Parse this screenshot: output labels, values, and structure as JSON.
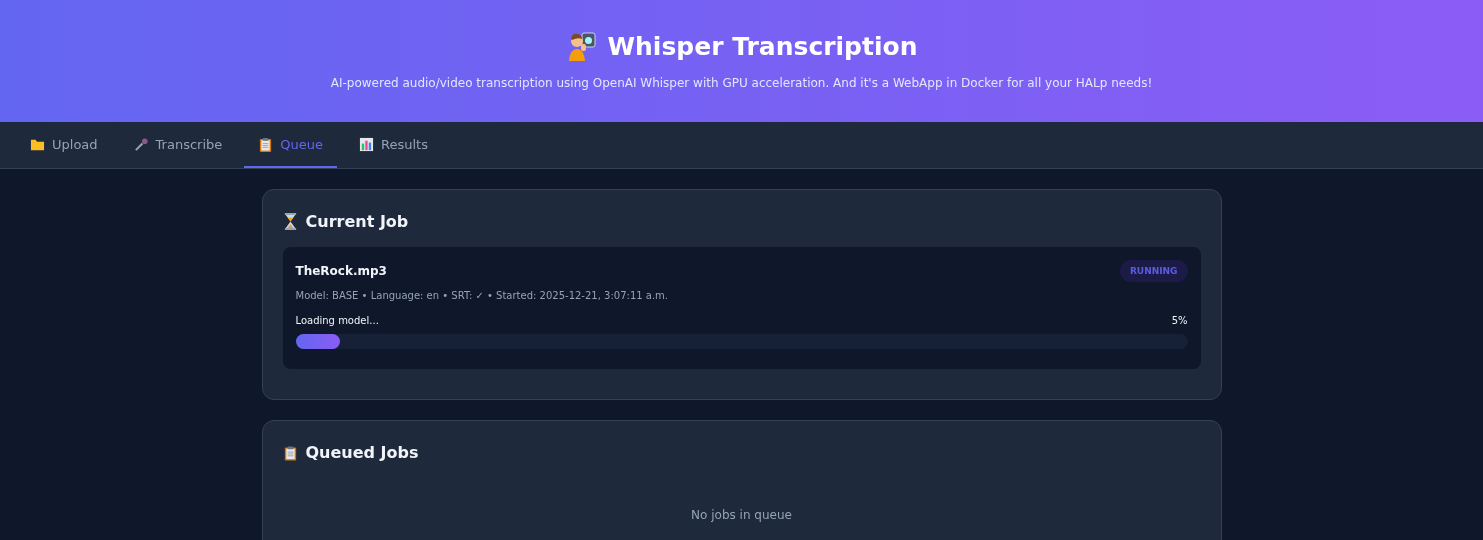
{
  "header": {
    "title": "Whisper Transcription",
    "subtitle": "AI-powered audio/video transcription using OpenAI Whisper with GPU acceleration. And it's a WebApp in Docker for all your HALp needs!"
  },
  "tabs": [
    {
      "label": "Upload",
      "selected": false
    },
    {
      "label": "Transcribe",
      "selected": false
    },
    {
      "label": "Queue",
      "selected": true
    },
    {
      "label": "Results",
      "selected": false
    }
  ],
  "current_job": {
    "title": "Current Job",
    "job": {
      "file": "TheRock.mp3",
      "status": "RUNNING",
      "details": "Model: BASE • Language: en • SRT: ✓ • Started: 2025-12-21, 3:07:11 a.m.",
      "stage": "Loading model...",
      "percent": "5%",
      "level": 0.05
    }
  },
  "queued_jobs": {
    "title": "Queued Jobs",
    "empty_message": "No jobs in queue"
  }
}
